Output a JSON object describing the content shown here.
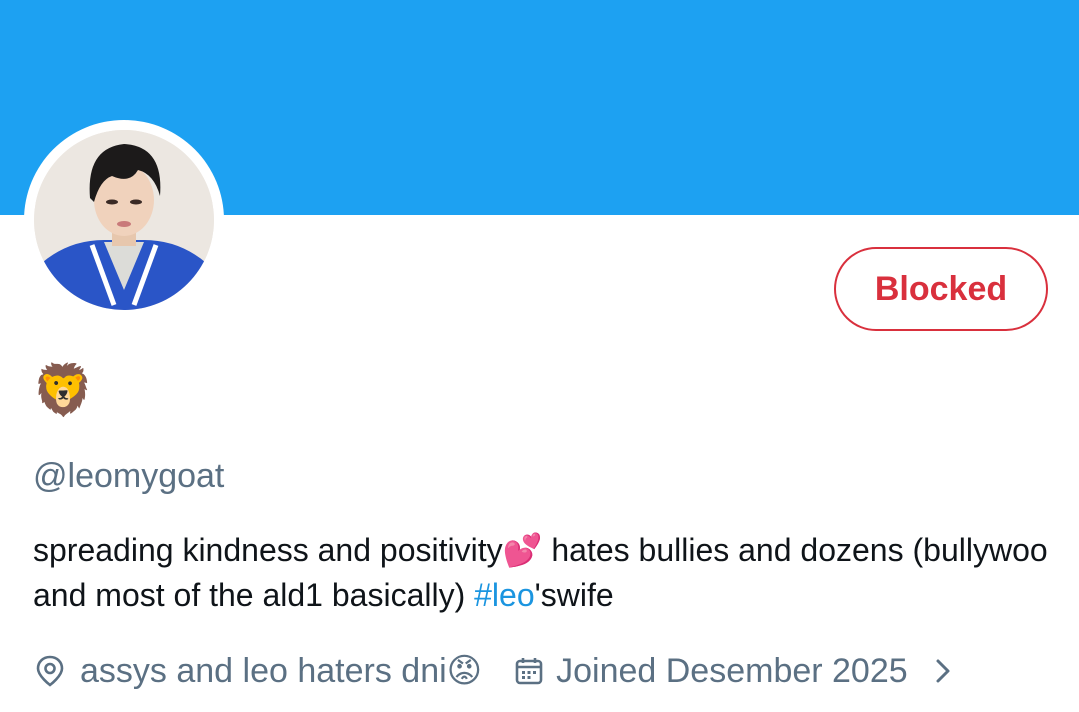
{
  "profile": {
    "display_name": "🦁",
    "handle": "@leomygoat",
    "action_button": "Blocked",
    "bio": {
      "text_1": "spreading kindness and positivity💕 hates bullies and dozens (bullywoo and most of the ald1 basically)  ",
      "hashtag": "#leo",
      "text_2": "'swife"
    },
    "location": "assys and leo haters dni😡",
    "joined": "Joined Desember 2025"
  },
  "colors": {
    "banner": "#1da1f2",
    "blocked": "#d9303d",
    "secondary_text": "#5b7083",
    "link": "#1b95e0"
  },
  "icons": [
    "location-pin-icon",
    "calendar-icon",
    "chevron-right-icon"
  ]
}
